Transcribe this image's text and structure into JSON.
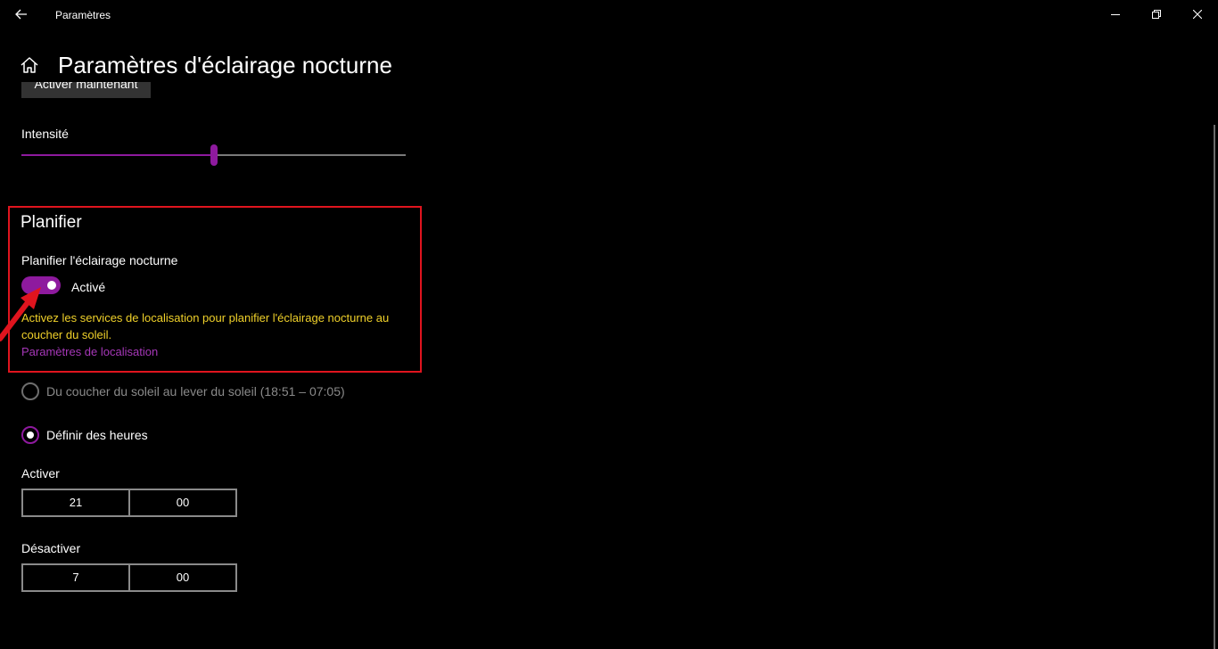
{
  "window": {
    "title": "Paramètres"
  },
  "header": {
    "title": "Paramètres d'éclairage nocturne"
  },
  "intensity": {
    "activate_now_label": "Activer maintenant",
    "label": "Intensité",
    "value_percent": 50
  },
  "schedule": {
    "section_title": "Planifier",
    "toggle_label": "Planifier l'éclairage nocturne",
    "toggle_on": true,
    "toggle_state": "Activé",
    "warning": "Activez les services de localisation pour planifier l'éclairage nocturne au coucher du soleil.",
    "location_link": "Paramètres de localisation",
    "option_sunset": "Du coucher du soleil au lever du soleil (18:51 – 07:05)",
    "option_custom": "Définir des heures",
    "selected_option": "custom",
    "on_label": "Activer",
    "on_hour": "21",
    "on_minute": "00",
    "off_label": "Désactiver",
    "off_hour": "7",
    "off_minute": "00"
  },
  "colors": {
    "accent": "#8e1a9e",
    "link": "#a637b8",
    "warning": "#f0d12a",
    "highlight": "#e0141e",
    "background": "#000000"
  }
}
